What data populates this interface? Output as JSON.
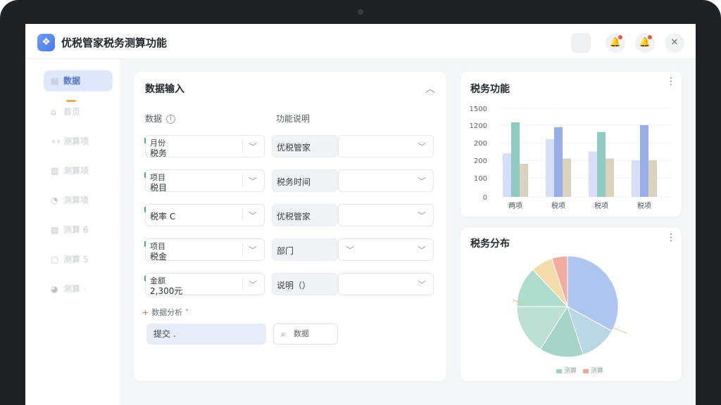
{
  "app": {
    "title": "优税管家税务测算功能",
    "logo_icon": "app-logo-icon",
    "accent_color": "#4a78e6"
  },
  "header": {
    "buttons": [
      {
        "name": "square-button",
        "icon": ""
      },
      {
        "name": "notification-icon",
        "icon": "🔔"
      },
      {
        "name": "alert-icon",
        "icon": "🔔"
      },
      {
        "name": "close-icon",
        "icon": "✕"
      }
    ]
  },
  "sidebar": {
    "items": [
      {
        "icon": "▤",
        "label": "数据"
      },
      {
        "icon": "⌂",
        "label": "首页"
      },
      {
        "icon": "∘∘",
        "label": "测算项"
      },
      {
        "icon": "▥",
        "label": "测算项"
      },
      {
        "icon": "◔",
        "label": "测算项"
      },
      {
        "icon": "▧",
        "label": "测算 6"
      },
      {
        "icon": "▢",
        "label": "测算 5"
      },
      {
        "icon": "◕",
        "label": "测算 ·"
      }
    ]
  },
  "input_panel": {
    "title": "数据输入",
    "collapse_icon": "︿",
    "left_header": "数据",
    "right_header": "功能说明",
    "left_fields": [
      {
        "label": "月份",
        "value": "税务"
      },
      {
        "label": "项目",
        "value": "税目"
      },
      {
        "label": "",
        "value": "税率 C"
      },
      {
        "label": "项目",
        "value": "税金"
      },
      {
        "label": "金额",
        "value": "2,300元"
      }
    ],
    "right_fields": [
      {
        "value": "优税管家"
      },
      {
        "value": "税务时间"
      },
      {
        "value": "优税管家"
      },
      {
        "value": "部门"
      },
      {
        "value": "说明（）"
      }
    ],
    "advanced_toggle": "数据分析",
    "primary_button": "提交 .",
    "search_button": "数据"
  },
  "bar_panel": {
    "title": "税务功能",
    "more_icon": "⋮"
  },
  "pie_panel": {
    "title": "税务分布",
    "more_icon": "⋮",
    "legend": [
      "测算",
      "测算"
    ]
  },
  "chart_data": [
    {
      "type": "bar",
      "categories": [
        "两项",
        "税项",
        "税项",
        "税项"
      ],
      "series": [
        {
          "values": [
            240,
            480,
            250,
            200
          ],
          "color": "#d6def8"
        },
        {
          "values": [
            1250,
            1100,
            850,
            1200
          ],
          "color": "#8fcbc2"
        },
        {
          "values": [
            180,
            210,
            210,
            200
          ],
          "color": "#d9d3bd"
        }
      ],
      "series_colors_by_category": [
        [
          "#d6def8",
          "#8fcbc2",
          "#d9d3bd"
        ],
        [
          "#d6def8",
          "#98aee8",
          "#d9d3bd"
        ],
        [
          "#d6def8",
          "#8fcbc2",
          "#d9d3bd"
        ],
        [
          "#d6def8",
          "#98aee8",
          "#d9d3bd"
        ]
      ],
      "yticks": [
        0,
        100,
        200,
        200,
        1200,
        1500
      ],
      "ylim": [
        0,
        1500
      ]
    },
    {
      "type": "pie",
      "slices": [
        {
          "value": 33,
          "color": "#a8c1ee"
        },
        {
          "value": 12,
          "color": "#b4d4e2"
        },
        {
          "value": 14,
          "color": "#9fd1c4"
        },
        {
          "value": 16,
          "color": "#b8ded2"
        },
        {
          "value": 13,
          "color": "#a8dac9"
        },
        {
          "value": 7,
          "color": "#f2d9a6"
        },
        {
          "value": 5,
          "color": "#f0a898"
        }
      ]
    }
  ]
}
